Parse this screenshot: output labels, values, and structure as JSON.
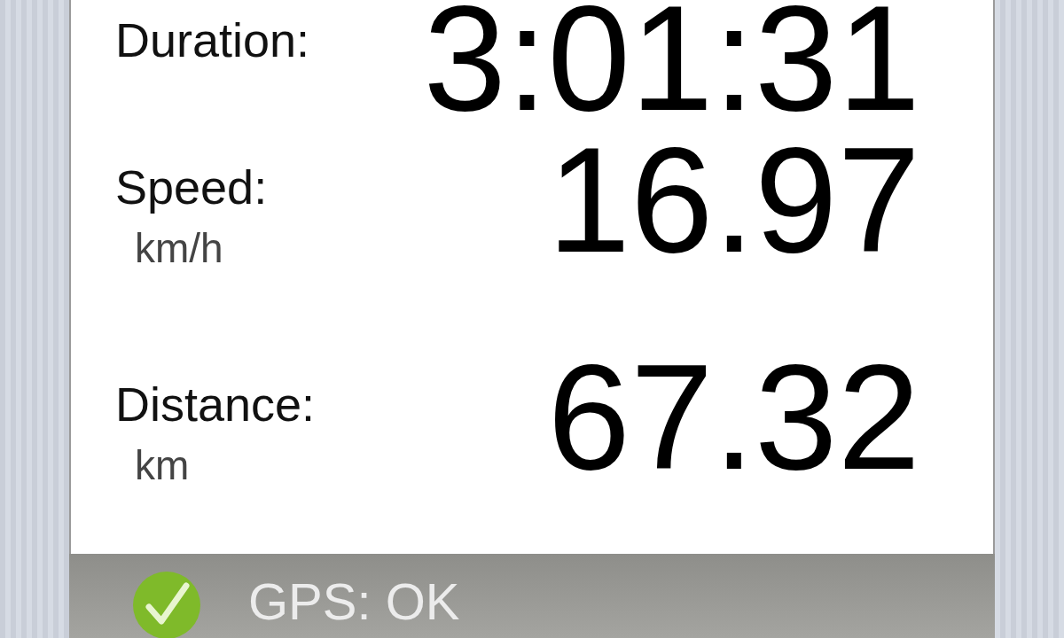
{
  "measurements": [
    {
      "label": "Duration:",
      "value": "3:01:31"
    },
    {
      "label": "Speed:",
      "unit": "km/h",
      "value": "16.97"
    },
    {
      "label": "Distance:",
      "unit": "km",
      "value": "67.32"
    }
  ],
  "status_bar": {
    "ok": true,
    "text": "GPS: OK"
  }
}
